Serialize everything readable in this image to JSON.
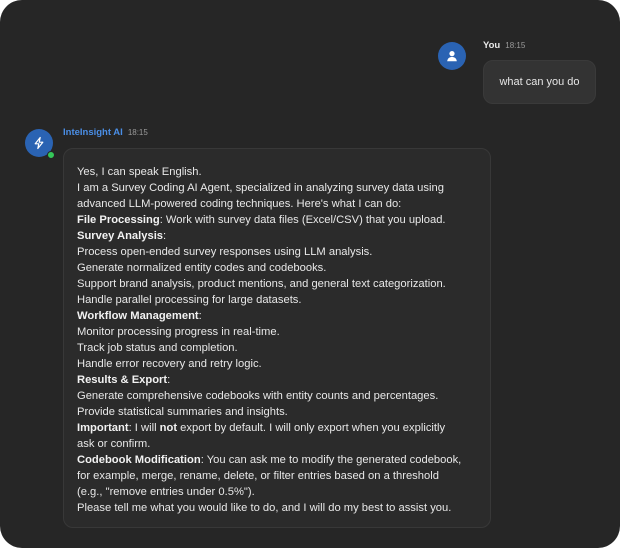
{
  "user_message": {
    "name": "You",
    "time": "18:15",
    "text": "what can you do"
  },
  "ai_message": {
    "name": "InteInsight AI",
    "time": "18:15",
    "lines": [
      [
        "",
        "Yes, I can speak English."
      ],
      [
        "",
        "I am a Survey Coding AI Agent, specialized in analyzing survey data using"
      ],
      [
        "",
        "advanced LLM-powered coding techniques. Here's what I can do:"
      ],
      [
        "File Processing",
        ": Work with survey data files (Excel/CSV) that you upload."
      ],
      [
        "Survey Analysis",
        ":"
      ],
      [
        "",
        "Process open-ended survey responses using LLM analysis."
      ],
      [
        "",
        "Generate normalized entity codes and codebooks."
      ],
      [
        "",
        "Support brand analysis, product mentions, and general text categorization."
      ],
      [
        "",
        "Handle parallel processing for large datasets."
      ],
      [
        "Workflow Management",
        ":"
      ],
      [
        "",
        "Monitor processing progress in real-time."
      ],
      [
        "",
        "Track job status and completion."
      ],
      [
        "",
        "Handle error recovery and retry logic."
      ],
      [
        "Results & Export",
        ":"
      ],
      [
        "",
        "Generate comprehensive codebooks with entity counts and percentages."
      ],
      [
        "",
        "Provide statistical summaries and insights."
      ],
      [
        "Important",
        ": I will ",
        "not",
        " export by default. I will only export when you explicitly"
      ],
      [
        "",
        "ask or confirm."
      ],
      [
        "Codebook Modification",
        ": You can ask me to modify the generated codebook,"
      ],
      [
        "",
        "for example, merge, rename, delete, or filter entries based on a threshold"
      ],
      [
        "",
        "(e.g., \"remove entries under 0.5%\")."
      ],
      [
        "",
        "Please tell me what you would like to do, and I will do my best to assist you."
      ]
    ]
  },
  "icons": {
    "user_avatar": "user-icon",
    "ai_avatar": "sparkle-icon",
    "status": "online-status-dot"
  },
  "colors": {
    "background": "#262626",
    "avatar": "#2a63b3",
    "ai_name": "#4a8ee6",
    "online": "#35c759"
  }
}
